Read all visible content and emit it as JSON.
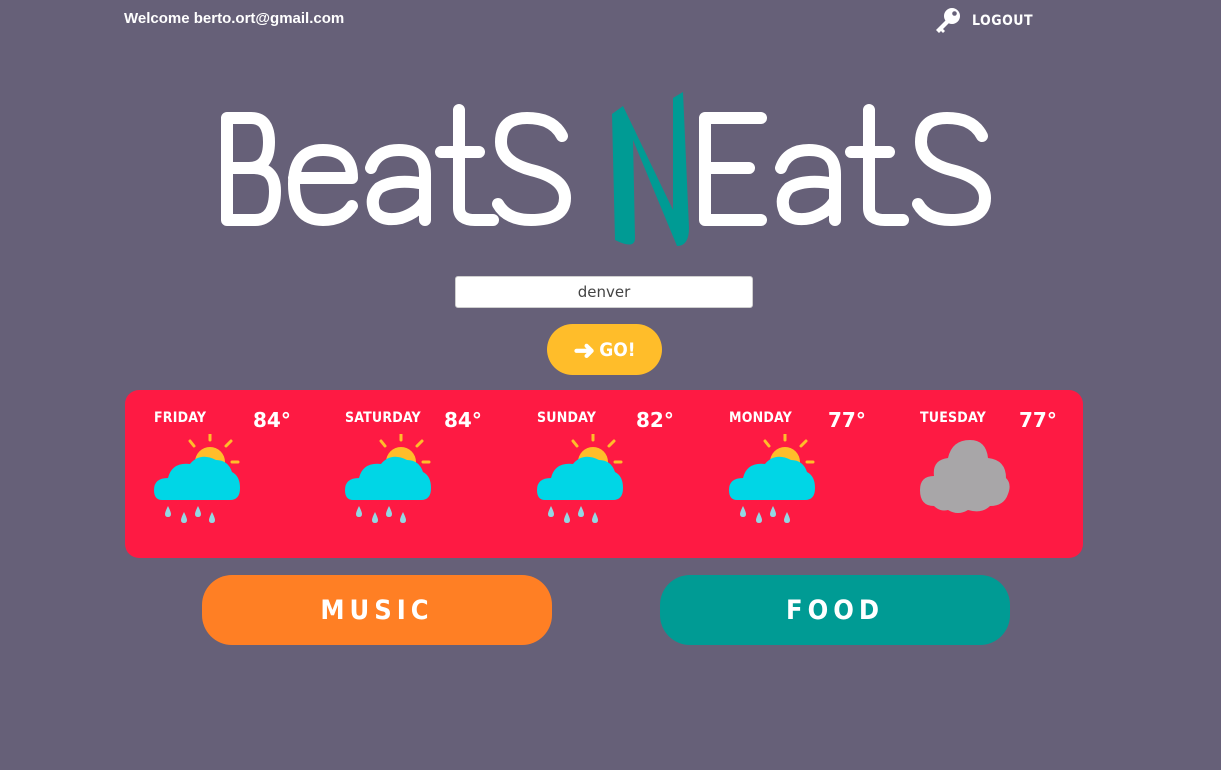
{
  "header": {
    "welcome_text": "Welcome berto.ort@gmail.com",
    "logout_label": "logout",
    "logout_icon": "key-icon"
  },
  "logo": {
    "text": "BeatsNeats",
    "accent_color": "#009b94"
  },
  "search": {
    "value": "denver",
    "placeholder": ""
  },
  "go_button": {
    "label": "GO!",
    "icon": "arrow-right-icon"
  },
  "forecast": [
    {
      "day": "Friday",
      "temp": "84°",
      "icon": "sun-rain-cloud-icon"
    },
    {
      "day": "Saturday",
      "temp": "84°",
      "icon": "sun-rain-cloud-icon"
    },
    {
      "day": "Sunday",
      "temp": "82°",
      "icon": "sun-rain-cloud-icon"
    },
    {
      "day": "Monday",
      "temp": "77°",
      "icon": "sun-rain-cloud-icon"
    },
    {
      "day": "Tuesday",
      "temp": "77°",
      "icon": "gray-cloud-icon"
    }
  ],
  "buttons": {
    "music_label": "MUSIC",
    "food_label": "FOOD"
  },
  "colors": {
    "background": "#666078",
    "forecast_panel": "#fe1a43",
    "go_button": "#ffbd2a",
    "music_button": "#ff7f24",
    "food_button": "#009b94"
  }
}
